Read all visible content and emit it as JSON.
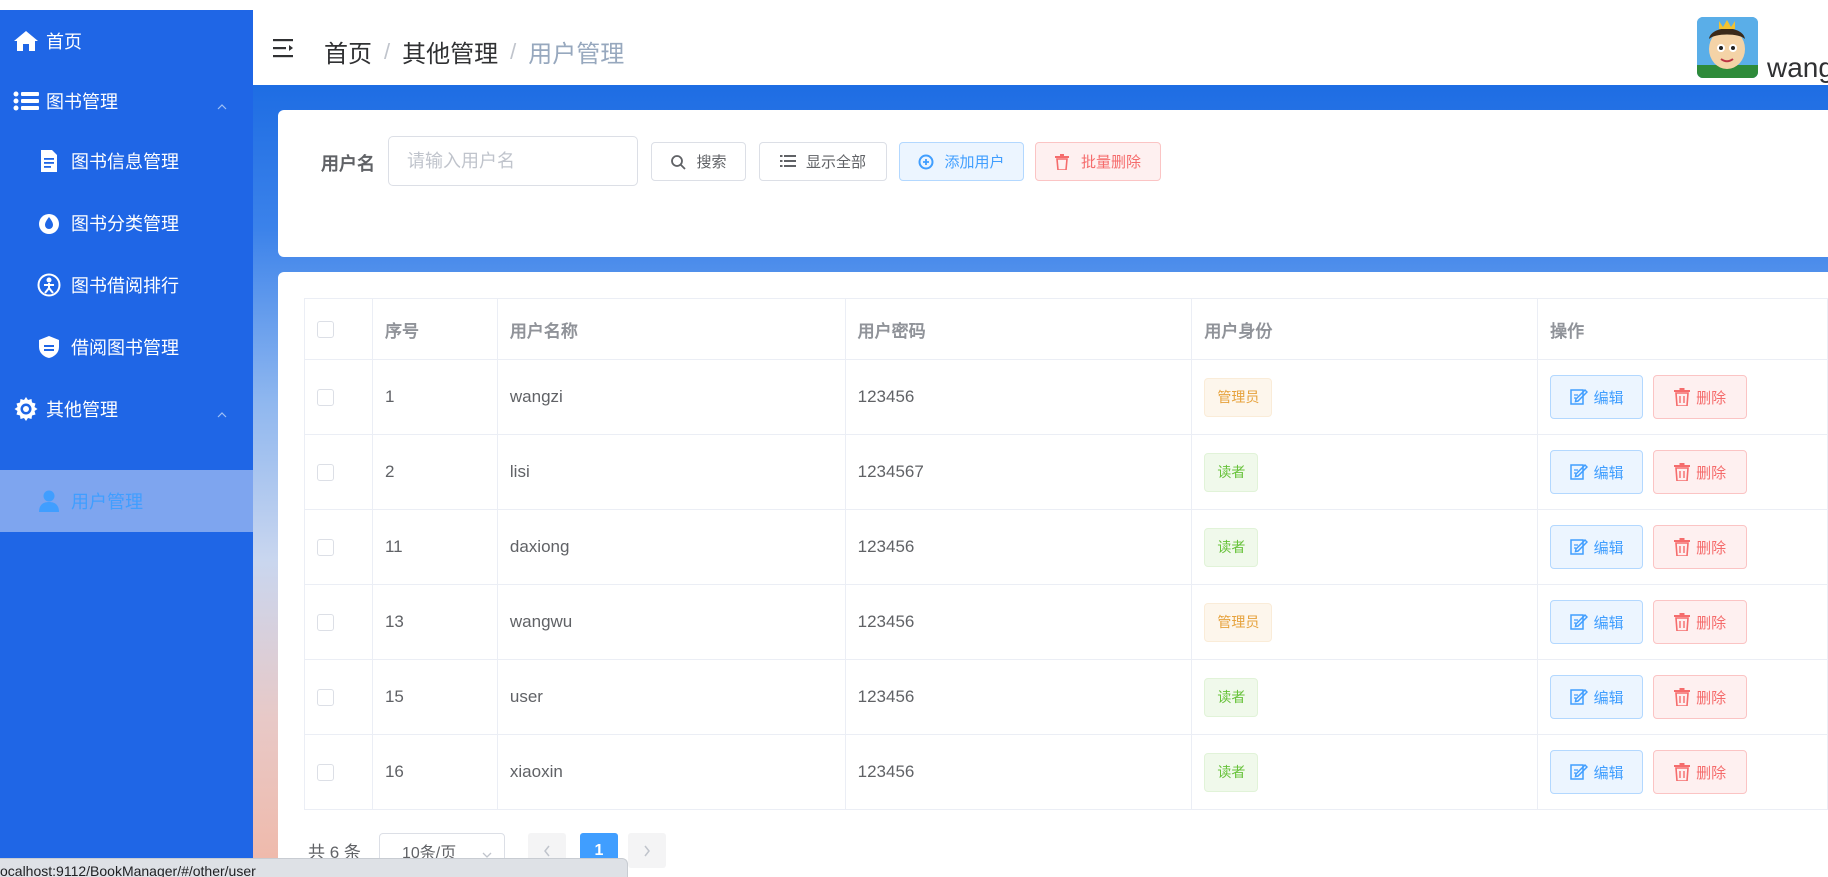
{
  "sidebar": {
    "home": "首页",
    "book_mgmt": "图书管理",
    "book_info": "图书信息管理",
    "book_category": "图书分类管理",
    "book_ranking": "图书借阅排行",
    "borrow_mgmt": "借阅图书管理",
    "other_mgmt": "其他管理",
    "user_mgmt": "用户管理"
  },
  "header": {
    "breadcrumb": [
      "首页",
      "其他管理",
      "用户管理"
    ],
    "username": "wang"
  },
  "search": {
    "label": "用户名",
    "placeholder": "请输入用户名",
    "search_btn": "搜索",
    "show_all_btn": "显示全部",
    "add_btn": "添加用户",
    "batch_delete_btn": "批量删除"
  },
  "table": {
    "columns": [
      "序号",
      "用户名称",
      "用户密码",
      "用户身份",
      "操作"
    ],
    "rows": [
      {
        "id": "1",
        "name": "wangzi",
        "password": "123456",
        "role": "管理员",
        "role_type": "admin"
      },
      {
        "id": "2",
        "name": "lisi",
        "password": "1234567",
        "role": "读者",
        "role_type": "reader"
      },
      {
        "id": "11",
        "name": "daxiong",
        "password": "123456",
        "role": "读者",
        "role_type": "reader"
      },
      {
        "id": "13",
        "name": "wangwu",
        "password": "123456",
        "role": "管理员",
        "role_type": "admin"
      },
      {
        "id": "15",
        "name": "user",
        "password": "123456",
        "role": "读者",
        "role_type": "reader"
      },
      {
        "id": "16",
        "name": "xiaoxin",
        "password": "123456",
        "role": "读者",
        "role_type": "reader"
      }
    ],
    "edit_label": "编辑",
    "delete_label": "删除"
  },
  "pagination": {
    "total": "共 6 条",
    "page_size": "10条/页",
    "current_page": "1"
  },
  "statusbar": {
    "url": "ocalhost:9112/BookManager/#/other/user"
  },
  "colors": {
    "sidebar": "#1f66e6",
    "primary": "#409eff",
    "danger": "#f56c6c",
    "warning": "#e6a23c",
    "success": "#67c23a"
  }
}
